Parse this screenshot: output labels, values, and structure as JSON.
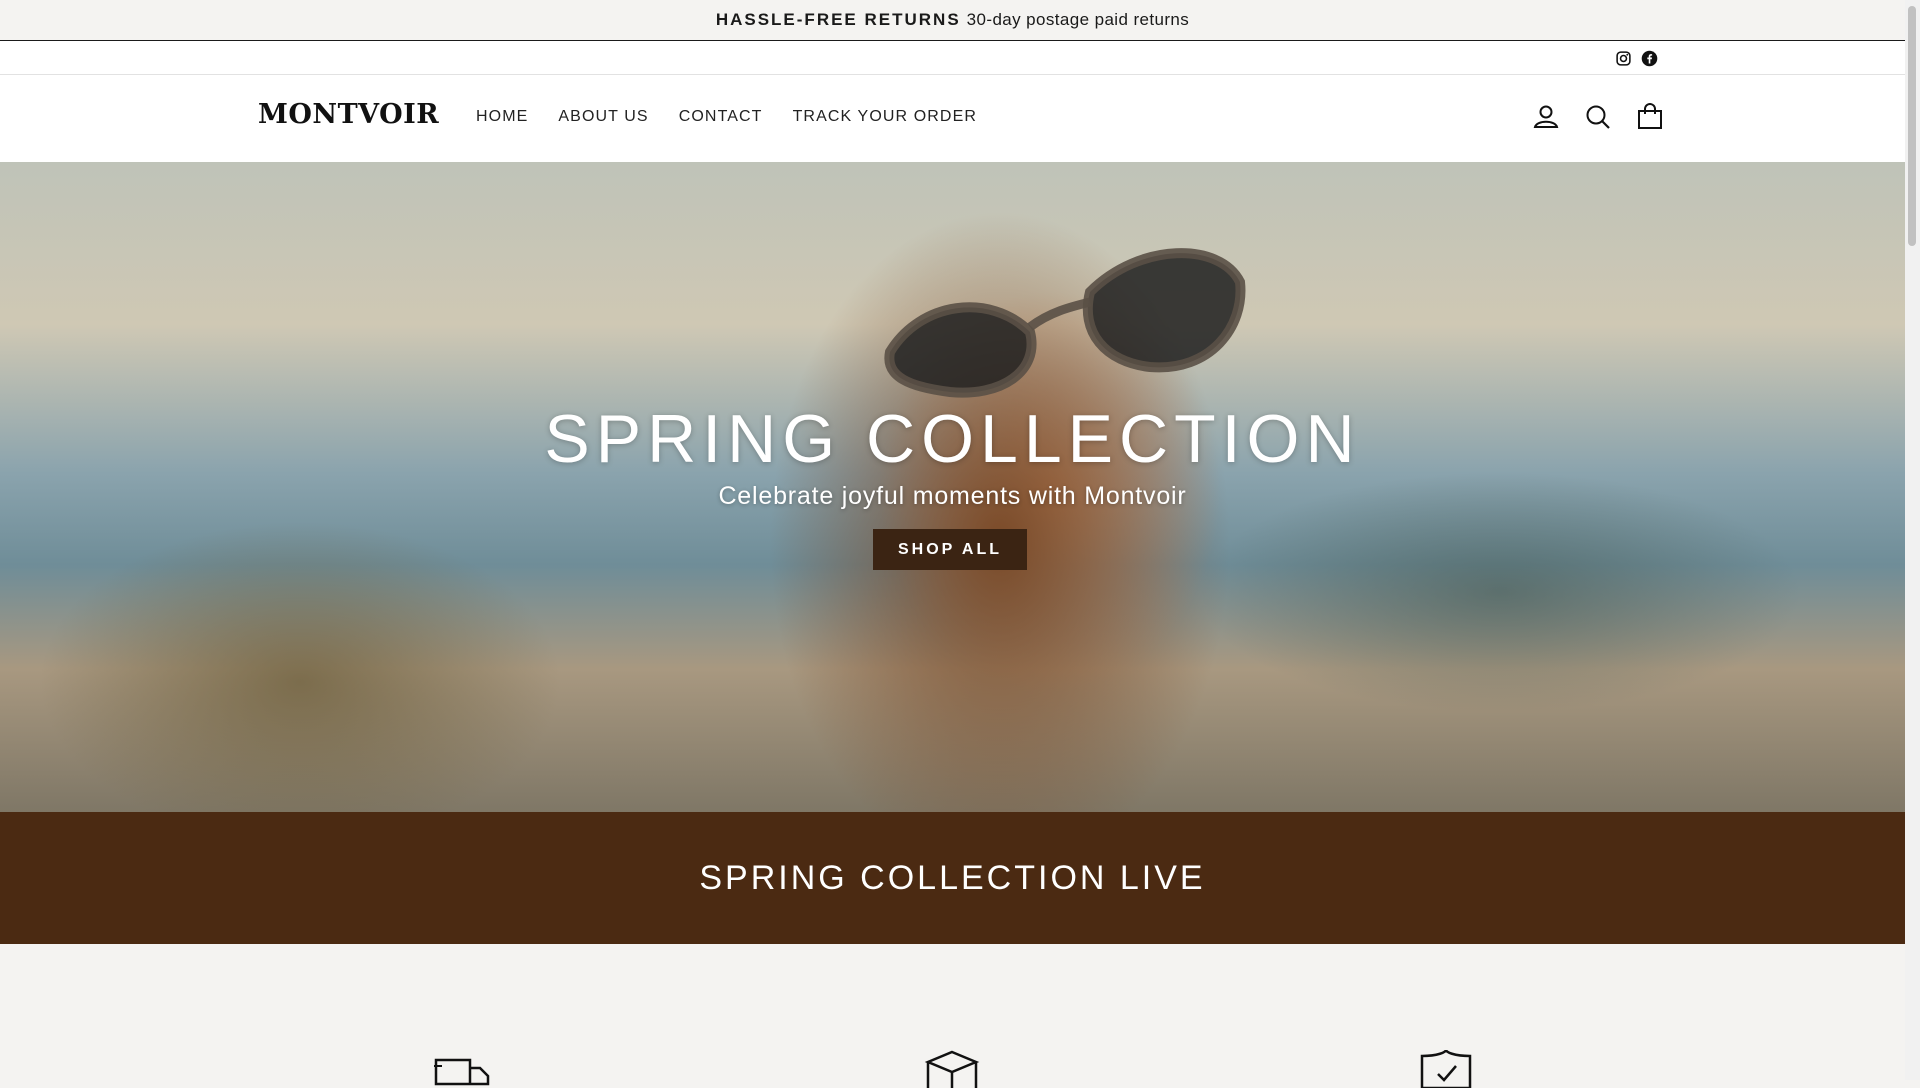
{
  "announcement": {
    "strong": "HASSLE-FREE RETURNS",
    "text": "30-day postage paid returns"
  },
  "social": [
    "instagram-icon",
    "facebook-icon"
  ],
  "header": {
    "logo": "MONTVOIR",
    "nav": [
      "HOME",
      "ABOUT US",
      "CONTACT",
      "TRACK YOUR ORDER"
    ],
    "icons": [
      "account-icon",
      "search-icon",
      "cart-icon"
    ]
  },
  "hero": {
    "title": "SPRING COLLECTION",
    "subtitle": "Celebrate joyful moments with Montvoir",
    "button": "SHOP ALL"
  },
  "banner": {
    "text": "SPRING COLLECTION LIVE"
  },
  "features": {
    "icons": [
      "delivery-truck-icon",
      "package-box-icon",
      "shield-check-icon"
    ]
  },
  "colors": {
    "banner_bg": "#4b2a12",
    "button_bg": "#3b2413",
    "page_bg": "#f4f3f1"
  }
}
